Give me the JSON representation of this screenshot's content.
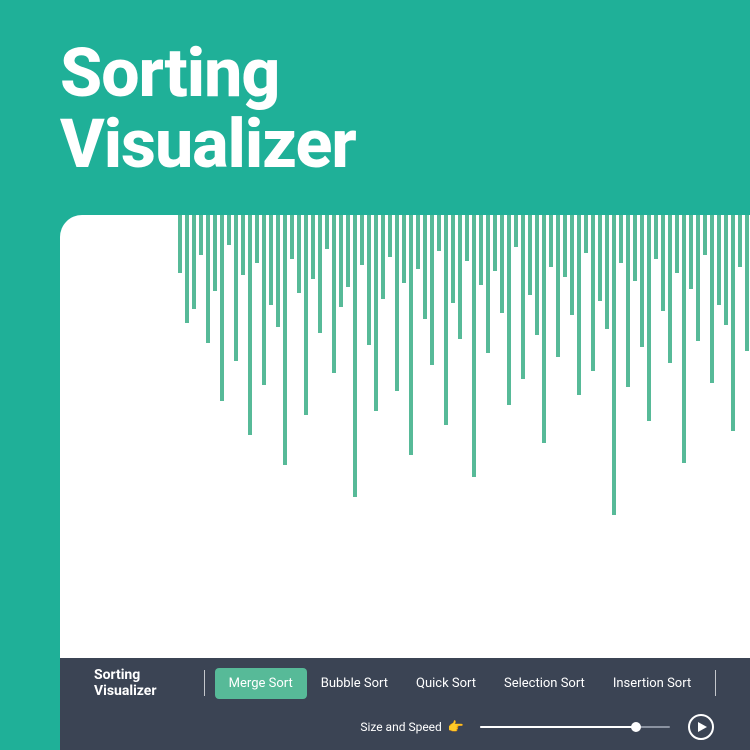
{
  "header": {
    "title_line1": "Sorting",
    "title_line2": "Visualizer"
  },
  "controls": {
    "brand": "Sorting Visualizer",
    "algorithms": [
      {
        "label": "Merge Sort",
        "active": true
      },
      {
        "label": "Bubble Sort",
        "active": false
      },
      {
        "label": "Quick Sort",
        "active": false
      },
      {
        "label": "Selection Sort",
        "active": false
      },
      {
        "label": "Insertion Sort",
        "active": false
      }
    ],
    "speed_label": "Size and Speed",
    "speed_pointer": "👉",
    "slider_percent": 82
  },
  "colors": {
    "page_bg": "#1fb098",
    "panel_bg": "#ffffff",
    "bar": "#57ba98",
    "controls_bg": "#3b4454",
    "active_algo": "#57ba98"
  },
  "bars": [
    58,
    108,
    94,
    40,
    128,
    76,
    186,
    30,
    146,
    60,
    220,
    48,
    170,
    90,
    112,
    250,
    44,
    78,
    200,
    64,
    118,
    34,
    158,
    92,
    72,
    282,
    50,
    130,
    196,
    84,
    42,
    176,
    68,
    240,
    54,
    104,
    150,
    36,
    210,
    88,
    124,
    46,
    262,
    70,
    138,
    56,
    98,
    190,
    32,
    164,
    80,
    120,
    228,
    52,
    142,
    62,
    100,
    180,
    38,
    156,
    86,
    114,
    300,
    48,
    172,
    66,
    132,
    206,
    44,
    96,
    148,
    58,
    248,
    74,
    126,
    40,
    168,
    90,
    110,
    216,
    52,
    136
  ]
}
